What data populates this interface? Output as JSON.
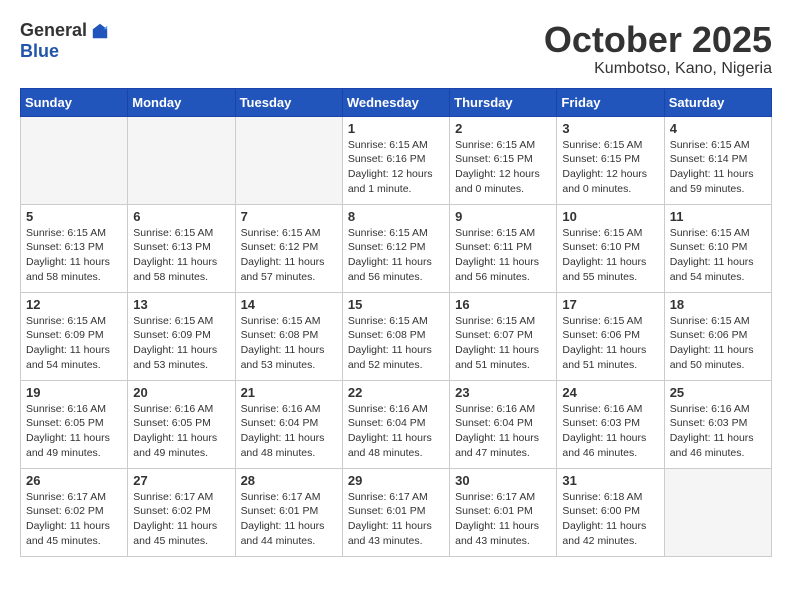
{
  "header": {
    "logo_general": "General",
    "logo_blue": "Blue",
    "month_title": "October 2025",
    "location": "Kumbotso, Kano, Nigeria"
  },
  "weekdays": [
    "Sunday",
    "Monday",
    "Tuesday",
    "Wednesday",
    "Thursday",
    "Friday",
    "Saturday"
  ],
  "weeks": [
    [
      {
        "day": "",
        "info": ""
      },
      {
        "day": "",
        "info": ""
      },
      {
        "day": "",
        "info": ""
      },
      {
        "day": "1",
        "info": "Sunrise: 6:15 AM\nSunset: 6:16 PM\nDaylight: 12 hours\nand 1 minute."
      },
      {
        "day": "2",
        "info": "Sunrise: 6:15 AM\nSunset: 6:15 PM\nDaylight: 12 hours\nand 0 minutes."
      },
      {
        "day": "3",
        "info": "Sunrise: 6:15 AM\nSunset: 6:15 PM\nDaylight: 12 hours\nand 0 minutes."
      },
      {
        "day": "4",
        "info": "Sunrise: 6:15 AM\nSunset: 6:14 PM\nDaylight: 11 hours\nand 59 minutes."
      }
    ],
    [
      {
        "day": "5",
        "info": "Sunrise: 6:15 AM\nSunset: 6:13 PM\nDaylight: 11 hours\nand 58 minutes."
      },
      {
        "day": "6",
        "info": "Sunrise: 6:15 AM\nSunset: 6:13 PM\nDaylight: 11 hours\nand 58 minutes."
      },
      {
        "day": "7",
        "info": "Sunrise: 6:15 AM\nSunset: 6:12 PM\nDaylight: 11 hours\nand 57 minutes."
      },
      {
        "day": "8",
        "info": "Sunrise: 6:15 AM\nSunset: 6:12 PM\nDaylight: 11 hours\nand 56 minutes."
      },
      {
        "day": "9",
        "info": "Sunrise: 6:15 AM\nSunset: 6:11 PM\nDaylight: 11 hours\nand 56 minutes."
      },
      {
        "day": "10",
        "info": "Sunrise: 6:15 AM\nSunset: 6:10 PM\nDaylight: 11 hours\nand 55 minutes."
      },
      {
        "day": "11",
        "info": "Sunrise: 6:15 AM\nSunset: 6:10 PM\nDaylight: 11 hours\nand 54 minutes."
      }
    ],
    [
      {
        "day": "12",
        "info": "Sunrise: 6:15 AM\nSunset: 6:09 PM\nDaylight: 11 hours\nand 54 minutes."
      },
      {
        "day": "13",
        "info": "Sunrise: 6:15 AM\nSunset: 6:09 PM\nDaylight: 11 hours\nand 53 minutes."
      },
      {
        "day": "14",
        "info": "Sunrise: 6:15 AM\nSunset: 6:08 PM\nDaylight: 11 hours\nand 53 minutes."
      },
      {
        "day": "15",
        "info": "Sunrise: 6:15 AM\nSunset: 6:08 PM\nDaylight: 11 hours\nand 52 minutes."
      },
      {
        "day": "16",
        "info": "Sunrise: 6:15 AM\nSunset: 6:07 PM\nDaylight: 11 hours\nand 51 minutes."
      },
      {
        "day": "17",
        "info": "Sunrise: 6:15 AM\nSunset: 6:06 PM\nDaylight: 11 hours\nand 51 minutes."
      },
      {
        "day": "18",
        "info": "Sunrise: 6:15 AM\nSunset: 6:06 PM\nDaylight: 11 hours\nand 50 minutes."
      }
    ],
    [
      {
        "day": "19",
        "info": "Sunrise: 6:16 AM\nSunset: 6:05 PM\nDaylight: 11 hours\nand 49 minutes."
      },
      {
        "day": "20",
        "info": "Sunrise: 6:16 AM\nSunset: 6:05 PM\nDaylight: 11 hours\nand 49 minutes."
      },
      {
        "day": "21",
        "info": "Sunrise: 6:16 AM\nSunset: 6:04 PM\nDaylight: 11 hours\nand 48 minutes."
      },
      {
        "day": "22",
        "info": "Sunrise: 6:16 AM\nSunset: 6:04 PM\nDaylight: 11 hours\nand 48 minutes."
      },
      {
        "day": "23",
        "info": "Sunrise: 6:16 AM\nSunset: 6:04 PM\nDaylight: 11 hours\nand 47 minutes."
      },
      {
        "day": "24",
        "info": "Sunrise: 6:16 AM\nSunset: 6:03 PM\nDaylight: 11 hours\nand 46 minutes."
      },
      {
        "day": "25",
        "info": "Sunrise: 6:16 AM\nSunset: 6:03 PM\nDaylight: 11 hours\nand 46 minutes."
      }
    ],
    [
      {
        "day": "26",
        "info": "Sunrise: 6:17 AM\nSunset: 6:02 PM\nDaylight: 11 hours\nand 45 minutes."
      },
      {
        "day": "27",
        "info": "Sunrise: 6:17 AM\nSunset: 6:02 PM\nDaylight: 11 hours\nand 45 minutes."
      },
      {
        "day": "28",
        "info": "Sunrise: 6:17 AM\nSunset: 6:01 PM\nDaylight: 11 hours\nand 44 minutes."
      },
      {
        "day": "29",
        "info": "Sunrise: 6:17 AM\nSunset: 6:01 PM\nDaylight: 11 hours\nand 43 minutes."
      },
      {
        "day": "30",
        "info": "Sunrise: 6:17 AM\nSunset: 6:01 PM\nDaylight: 11 hours\nand 43 minutes."
      },
      {
        "day": "31",
        "info": "Sunrise: 6:18 AM\nSunset: 6:00 PM\nDaylight: 11 hours\nand 42 minutes."
      },
      {
        "day": "",
        "info": ""
      }
    ]
  ]
}
